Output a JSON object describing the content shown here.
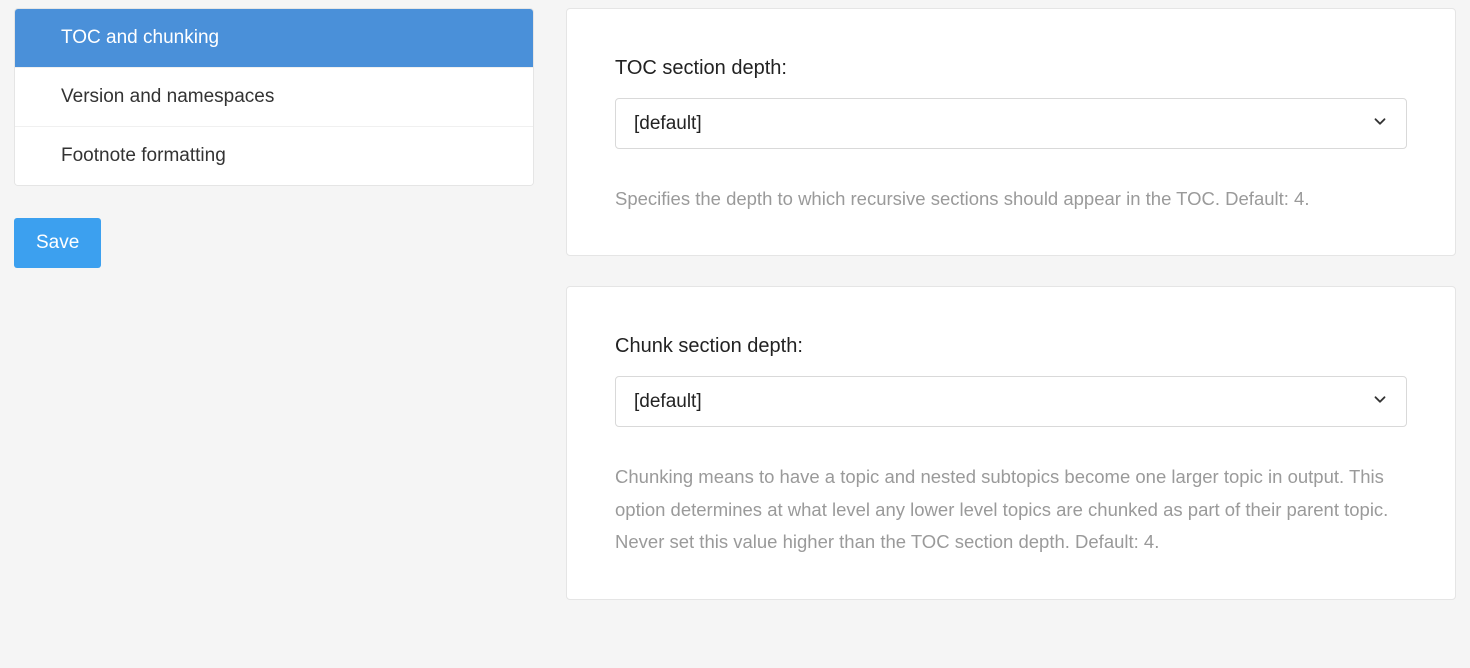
{
  "sidebar": {
    "items": [
      {
        "label": "TOC and chunking",
        "active": true
      },
      {
        "label": "Version and namespaces",
        "active": false
      },
      {
        "label": "Footnote formatting",
        "active": false
      }
    ],
    "save_label": "Save"
  },
  "main": {
    "cards": [
      {
        "label": "TOC section depth:",
        "selected": "[default]",
        "help": "Specifies the depth to which recursive sections should appear in the TOC. Default: 4."
      },
      {
        "label": "Chunk section depth:",
        "selected": "[default]",
        "help": "Chunking means to have a topic and nested subtopics become one larger topic in output. This option determines at what level any lower level topics are chunked as part of their parent topic. Never set this value higher than the TOC section depth. Default: 4."
      }
    ]
  }
}
